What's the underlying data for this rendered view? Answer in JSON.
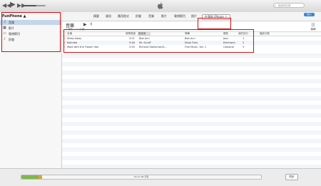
{
  "toolbar": {
    "volume_level": 0.6,
    "search_placeholder": "搜尋資料庫"
  },
  "sidebar": {
    "device_name": "FunPhone ▲",
    "items": [
      {
        "label": "音樂",
        "icon": "music-note-icon",
        "selected": true,
        "color": "#1b66c9"
      },
      {
        "label": "影片",
        "icon": "film-icon",
        "selected": false,
        "color": "#333333"
      },
      {
        "label": "電視節目",
        "icon": "tv-icon",
        "selected": false,
        "color": "#333333"
      },
      {
        "label": "鈴聲",
        "icon": "bell-icon",
        "selected": false,
        "color": "#d04a10"
      }
    ]
  },
  "nav": {
    "tabs": [
      "摘要",
      "資訊",
      "應用程式",
      "鈴聲",
      "音樂",
      "影片",
      "電視節目",
      "照片"
    ],
    "on_device_tab": "在我的 iPhone 上",
    "add_label": "加入"
  },
  "content": {
    "title": "音樂",
    "subtitle": "3 首歌 · 12 分鐘",
    "edit_label": "編輯"
  },
  "table": {
    "headers": [
      "名稱",
      "時間長度",
      "藝術家",
      "專輯",
      "類型",
      "我的評分",
      "播放次數"
    ],
    "rows": [
      {
        "name": "Sleep Away",
        "time": "3:21",
        "artist": "Bob Acri",
        "album": "Bob Acri",
        "genre": "Jazz",
        "rating": "",
        "plays": "1"
      },
      {
        "name": "Kalimba",
        "time": "5:48",
        "artist": "Mr. Scruff",
        "album": "Ninja Tuna",
        "genre": "Electronic",
        "rating": "",
        "plays": "2"
      },
      {
        "name": "Maid with the Flaxen Hair",
        "time": "2:50",
        "artist": "Richard Stoltzman/S...",
        "album": "Fine Music, Vol. 1",
        "genre": "Classical",
        "rating": "",
        "plays": "3"
      }
    ]
  },
  "capacity": {
    "label": "26.21 GB 可用",
    "segments": [
      {
        "name": "audio",
        "fraction": 0.07,
        "color": "#7fb64a"
      },
      {
        "name": "other",
        "fraction": 0.015,
        "color": "#e0a13a"
      }
    ]
  },
  "footer": {
    "sync_label": "同步"
  },
  "colors": {
    "highlight_box": "#d01010",
    "accent": "#3b86d6"
  }
}
